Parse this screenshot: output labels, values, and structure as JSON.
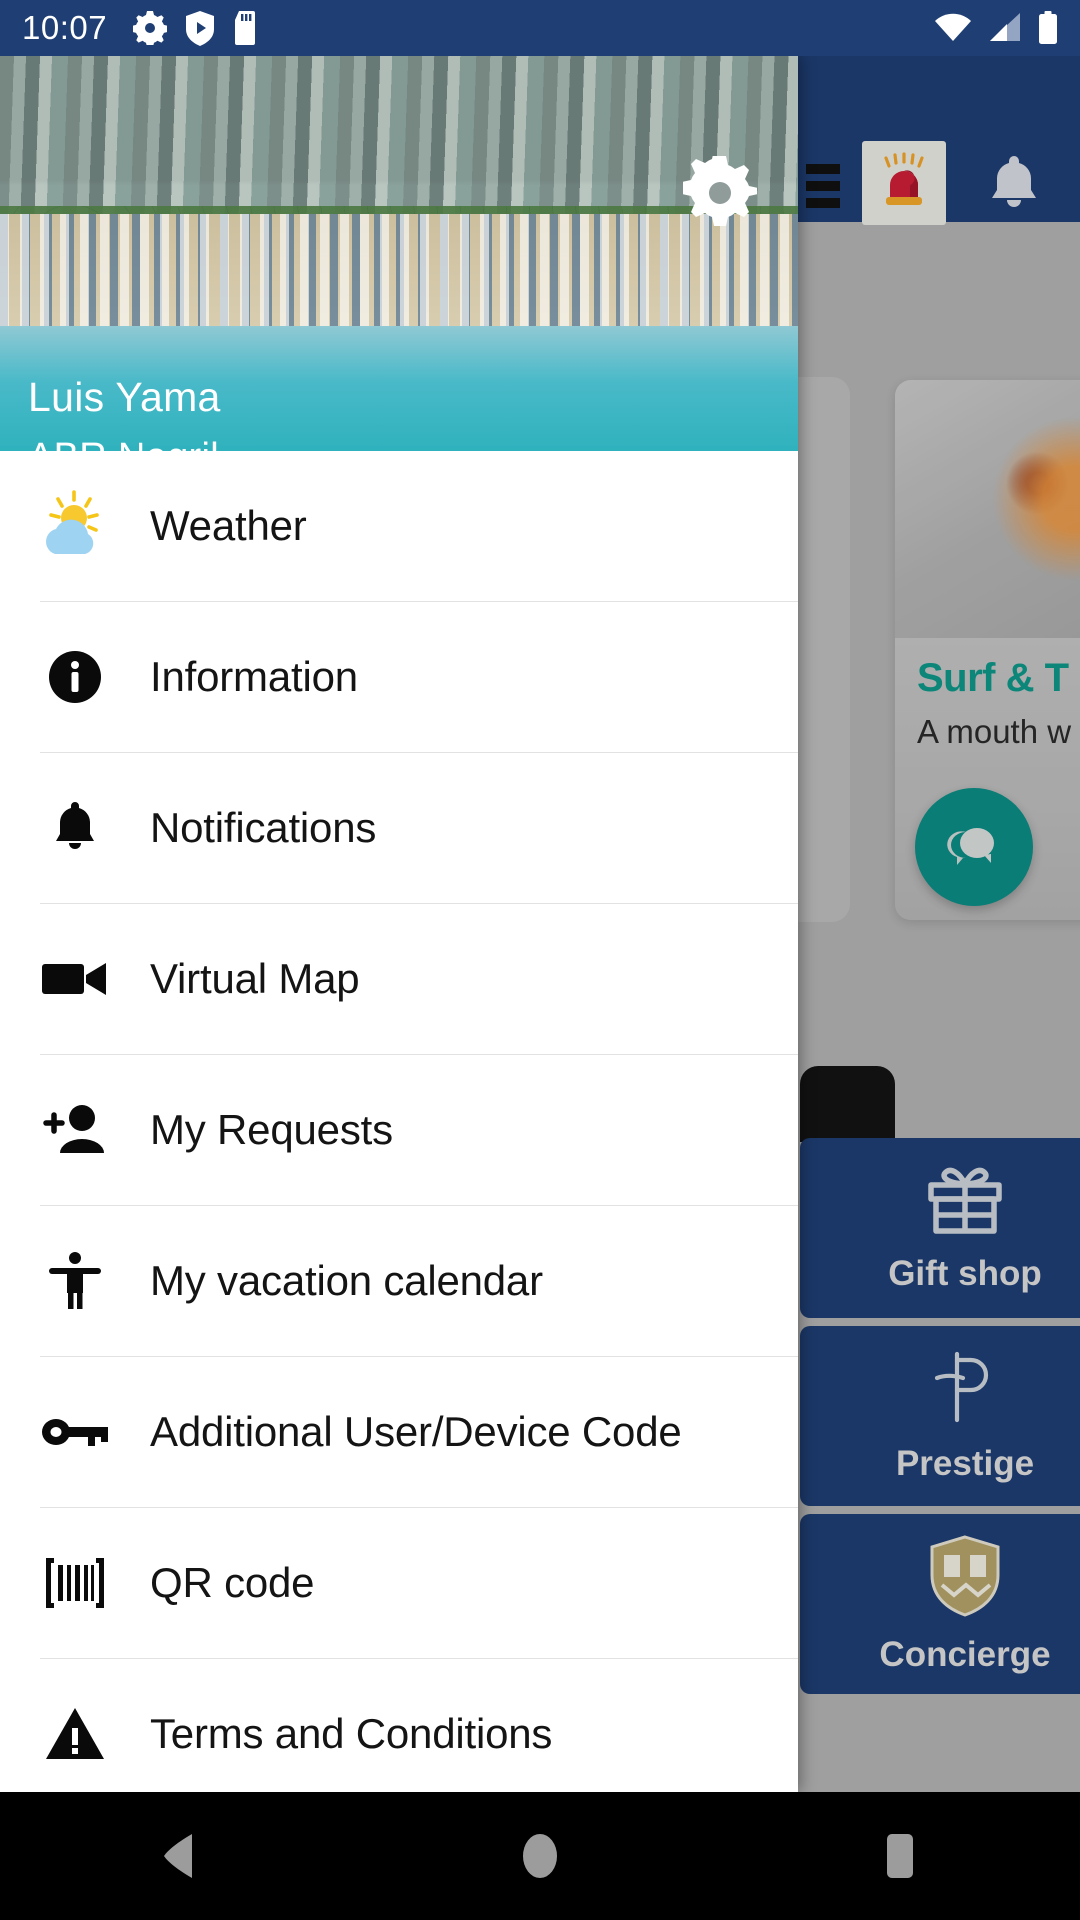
{
  "status_bar": {
    "clock": "10:07",
    "left_icons": [
      "gear-icon",
      "shield-play-icon",
      "sd-card-icon"
    ],
    "right_icons": [
      "wifi-icon",
      "cellular-signal-icon",
      "battery-icon"
    ],
    "background_color": "#1f3e73"
  },
  "app_bar": {
    "background_color": "#1f3e73",
    "menu_icon": "hamburger-menu-icon",
    "alarm_icon": "emergency-siren-icon",
    "bell_icon": "notifications-bell-icon"
  },
  "drawer": {
    "user_name": "Luis Yama",
    "resort_name": "ABR Negril",
    "settings_icon": "gear-icon",
    "header_image": "aerial-resort-beach-photo",
    "accent_color": "#2fb2bd",
    "items": [
      {
        "label": "Weather",
        "icon": "sun-cloud-weather-icon"
      },
      {
        "label": "Information",
        "icon": "info-circle-icon"
      },
      {
        "label": "Notifications",
        "icon": "bell-icon"
      },
      {
        "label": "Virtual Map",
        "icon": "video-camera-icon"
      },
      {
        "label": "My Requests",
        "icon": "person-add-icon"
      },
      {
        "label": "My vacation calendar",
        "icon": "accessibility-person-icon"
      },
      {
        "label": "Additional User/Device Code",
        "icon": "key-icon"
      },
      {
        "label": "QR code",
        "icon": "barcode-icon"
      },
      {
        "label": "Terms and Conditions",
        "icon": "warning-triangle-icon"
      }
    ]
  },
  "background_content": {
    "promo_card": {
      "title": "Surf & T",
      "subtitle": "A mouth w",
      "title_color": "#0f9688"
    },
    "chat_fab": {
      "icon": "chat-bubbles-icon",
      "color": "#0b8c84"
    },
    "tiles": [
      {
        "label": "Gift shop",
        "icon": "gift-box-icon"
      },
      {
        "label": "Prestige",
        "icon": "prestige-p-logo-icon"
      },
      {
        "label": "Concierge",
        "icon": "concierge-shield-crest-icon"
      }
    ],
    "tile_color": "#1f3e73"
  },
  "nav_bar": {
    "back_icon": "back-triangle-icon",
    "home_icon": "home-circle-icon",
    "recents_icon": "recents-square-icon",
    "background_color": "#000000"
  }
}
